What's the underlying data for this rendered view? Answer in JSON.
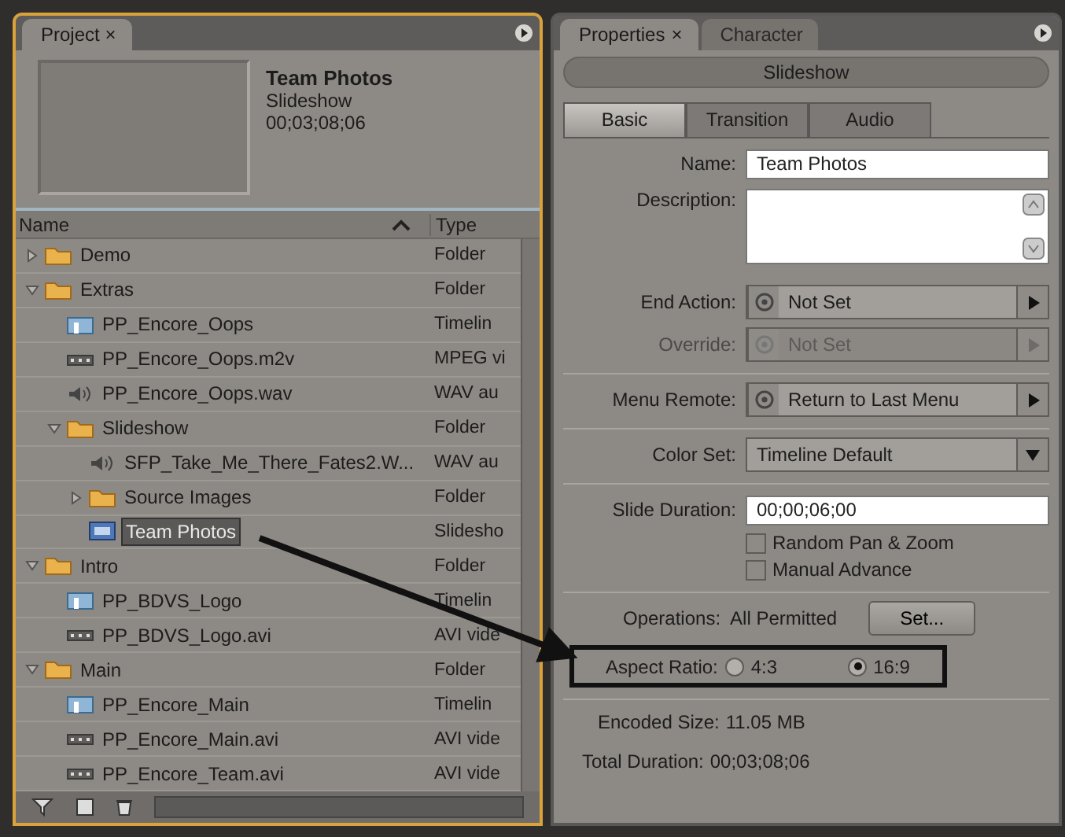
{
  "project": {
    "tab": "Project",
    "tab_close": "×",
    "preview": {
      "title": "Team Photos",
      "kind": "Slideshow",
      "duration": "00;03;08;06"
    },
    "columns": [
      "Name",
      "Type"
    ],
    "tree": [
      {
        "name": "Demo",
        "type": "Folder",
        "kind": "folder",
        "expanded": false,
        "selected": false
      },
      {
        "name": "Extras",
        "type": "Folder",
        "kind": "folder",
        "expanded": true,
        "selected": false,
        "children": [
          {
            "name": "PP_Encore_Oops",
            "type": "Timelin",
            "kind": "timeline",
            "selected": false
          },
          {
            "name": "PP_Encore_Oops.m2v",
            "type": "MPEG vi",
            "kind": "video",
            "selected": false
          },
          {
            "name": "PP_Encore_Oops.wav",
            "type": "WAV au",
            "kind": "audio",
            "selected": false
          },
          {
            "name": "Slideshow",
            "type": "Folder",
            "kind": "folder",
            "expanded": true,
            "selected": false,
            "children": [
              {
                "name": "SFP_Take_Me_There_Fates2.W...",
                "type": "WAV au",
                "kind": "audio",
                "selected": false
              },
              {
                "name": "Source Images",
                "type": "Folder",
                "kind": "folder",
                "expanded": false,
                "selected": false
              },
              {
                "name": "Team Photos",
                "type": "Slidesho",
                "kind": "slideshow",
                "selected": true
              }
            ]
          }
        ]
      },
      {
        "name": "Intro",
        "type": "Folder",
        "kind": "folder",
        "expanded": true,
        "selected": false,
        "children": [
          {
            "name": "PP_BDVS_Logo",
            "type": "Timelin",
            "kind": "timeline",
            "selected": false
          },
          {
            "name": "PP_BDVS_Logo.avi",
            "type": "AVI vide",
            "kind": "video",
            "selected": false
          }
        ]
      },
      {
        "name": "Main",
        "type": "Folder",
        "kind": "folder",
        "expanded": true,
        "selected": false,
        "children": [
          {
            "name": "PP_Encore_Main",
            "type": "Timelin",
            "kind": "timeline",
            "selected": false
          },
          {
            "name": "PP_Encore_Main.avi",
            "type": "AVI vide",
            "kind": "video",
            "selected": false
          },
          {
            "name": "PP_Encore_Team.avi",
            "type": "AVI vide",
            "kind": "video",
            "selected": false
          }
        ]
      }
    ]
  },
  "properties": {
    "tabs": [
      {
        "label": "Properties",
        "close": "×",
        "selected": true
      },
      {
        "label": "Character",
        "selected": false
      }
    ],
    "header": "Slideshow",
    "subtabs": [
      {
        "label": "Basic",
        "selected": true
      },
      {
        "label": "Transition",
        "selected": false
      },
      {
        "label": "Audio",
        "selected": false
      }
    ],
    "name": {
      "label": "Name:",
      "value": "Team Photos"
    },
    "description": {
      "label": "Description:"
    },
    "actions": [
      {
        "label": "End Action:",
        "value": "Not Set",
        "disabled": false
      },
      {
        "label": "Override:",
        "value": "Not Set",
        "disabled": true
      }
    ],
    "menu_remote": {
      "label": "Menu Remote:",
      "value": "Return to Last Menu"
    },
    "color_set": {
      "label": "Color Set:",
      "value": "Timeline Default"
    },
    "slide_duration": {
      "label": "Slide Duration:",
      "value": "00;00;06;00"
    },
    "checkboxes": [
      {
        "label": "Random Pan & Zoom",
        "checked": false
      },
      {
        "label": "Manual Advance",
        "checked": false
      }
    ],
    "operations": {
      "label": "Operations:",
      "value": "All Permitted",
      "button": "Set..."
    },
    "aspect_ratio": {
      "label": "Aspect Ratio:",
      "options": [
        {
          "label": "4:3",
          "selected": false
        },
        {
          "label": "16:9",
          "selected": true
        }
      ]
    },
    "encoded_size": {
      "label": "Encoded Size:",
      "value": "11.05 MB"
    },
    "total_duration": {
      "label": "Total Duration:",
      "value": "00;03;08;06"
    }
  }
}
